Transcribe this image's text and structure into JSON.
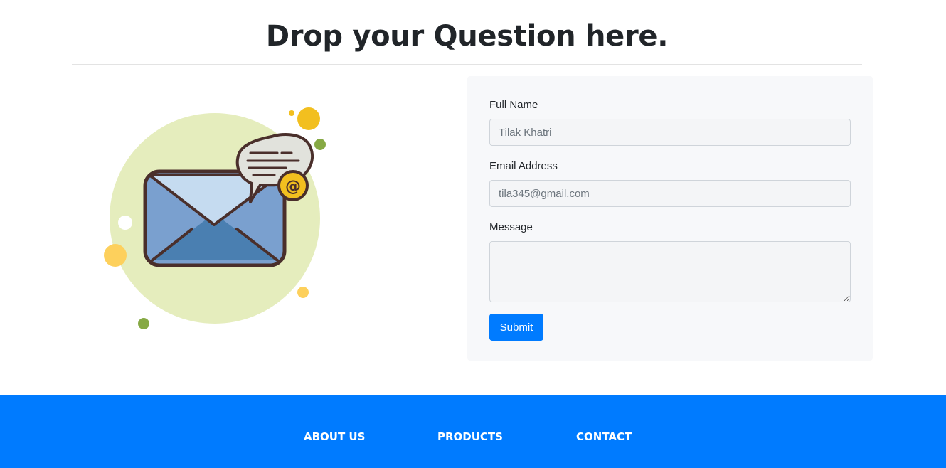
{
  "page": {
    "title": "Drop your Question here."
  },
  "form": {
    "full_name": {
      "label": "Full Name",
      "placeholder": "Tilak Khatri"
    },
    "email": {
      "label": "Email Address",
      "placeholder": "tila345@gmail.com"
    },
    "message": {
      "label": "Message",
      "placeholder": ""
    },
    "submit_label": "Submit"
  },
  "illustration": {
    "icon": "mail-envelope-icon",
    "badge_symbol": "@"
  },
  "footer": {
    "links": [
      {
        "label": "ABOUT US"
      },
      {
        "label": "PRODUCTS"
      },
      {
        "label": "CONTACT"
      }
    ]
  },
  "colors": {
    "primary": "#007bff",
    "form_background": "#f7f8fa",
    "heading_text": "#212529"
  }
}
